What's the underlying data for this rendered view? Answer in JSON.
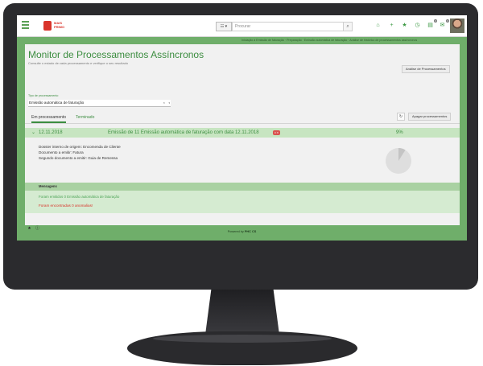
{
  "colors": {
    "accent": "#3c8d40",
    "screen_bg": "#6fae6a",
    "panel_bg": "#f1f1f1",
    "row_header": "#c7e5c1",
    "warning": "#d9342b",
    "bezel": "#2b2b2e"
  },
  "topbar": {
    "brand": "MAIS PRIMO",
    "search_placeholder": "Procurar",
    "icons": [
      "home-icon",
      "plus-icon",
      "star-icon",
      "clock-icon",
      "notebook-icon",
      "mail-icon",
      "chat-icon"
    ],
    "badges": {
      "notebook": "0",
      "mail": "0",
      "chat": "0"
    }
  },
  "breadcrumb": "Iniciação à Emissão de faturação · Preparação · Emissão automática de faturação · Análise de histórico de processamentos assíncronos",
  "page": {
    "title": "Monitor de Processamentos Assíncronos",
    "subtitle": "Consulte o estado de cada processamento e verifique o seu resultado",
    "analysis_button": "Análise de Processamentos"
  },
  "filter": {
    "label": "Tipo de processamento",
    "value": "Emissão automática de faturação",
    "clear": "×",
    "caret": "▾"
  },
  "tabs": {
    "in_progress": "Em processamento",
    "finished": "Terminado",
    "delete_button": "Apagar processamentos"
  },
  "process": {
    "date": "12.11.2018",
    "description": "Emissão de 11 Emissão automática de faturação com data 12.11.2018",
    "badge": "0 ✕",
    "percent": "9%",
    "progress": 0.09,
    "details": [
      "Dossier interno de origem: Encomenda de Cliente",
      "Documento a emitir: Fatura",
      "Segundo documento a emitir: Guia de Remessa"
    ]
  },
  "messages": {
    "header": "Mensagens",
    "info": "Foram emitidos 0 Emissão automática de faturação",
    "warning": "Foram encontradas 0 anomalias!"
  },
  "bottom_buttons": {
    "star": "★",
    "info": "ⓘ"
  },
  "footer": {
    "prefix": "Powered by",
    "brand": "PHC CS"
  }
}
